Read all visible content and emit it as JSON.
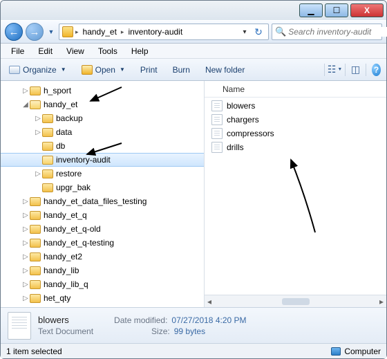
{
  "title": "",
  "winbuttons": {
    "min": "▁",
    "max": "☐",
    "close": "X"
  },
  "breadcrumb": {
    "p1": "handy_et",
    "p2": "inventory-audit"
  },
  "search": {
    "placeholder": "Search inventory-audit"
  },
  "menu": {
    "file": "File",
    "edit": "Edit",
    "view": "View",
    "tools": "Tools",
    "help": "Help"
  },
  "toolbar": {
    "organize": "Organize",
    "open": "Open",
    "print": "Print",
    "burn": "Burn",
    "newfolder": "New folder"
  },
  "column": {
    "name": "Name"
  },
  "tree": [
    {
      "indent": 30,
      "exp": "▷",
      "label": "h_sport",
      "open": false
    },
    {
      "indent": 30,
      "exp": "◢",
      "label": "handy_et",
      "open": true
    },
    {
      "indent": 48,
      "exp": "▷",
      "label": "backup",
      "open": false
    },
    {
      "indent": 48,
      "exp": "▷",
      "label": "data",
      "open": false
    },
    {
      "indent": 48,
      "exp": "",
      "label": "db",
      "open": false
    },
    {
      "indent": 48,
      "exp": "",
      "label": "inventory-audit",
      "open": true,
      "sel": true
    },
    {
      "indent": 48,
      "exp": "▷",
      "label": "restore",
      "open": false
    },
    {
      "indent": 48,
      "exp": "",
      "label": "upgr_bak",
      "open": false
    },
    {
      "indent": 30,
      "exp": "▷",
      "label": "handy_et_data_files_testing",
      "open": false
    },
    {
      "indent": 30,
      "exp": "▷",
      "label": "handy_et_q",
      "open": false
    },
    {
      "indent": 30,
      "exp": "▷",
      "label": "handy_et_q-old",
      "open": false
    },
    {
      "indent": 30,
      "exp": "▷",
      "label": "handy_et_q-testing",
      "open": false
    },
    {
      "indent": 30,
      "exp": "▷",
      "label": "handy_et2",
      "open": false
    },
    {
      "indent": 30,
      "exp": "▷",
      "label": "handy_lib",
      "open": false
    },
    {
      "indent": 30,
      "exp": "▷",
      "label": "handy_lib_q",
      "open": false
    },
    {
      "indent": 30,
      "exp": "▷",
      "label": "het_qty",
      "open": false
    }
  ],
  "files": [
    {
      "name": "blowers"
    },
    {
      "name": "chargers"
    },
    {
      "name": "compressors"
    },
    {
      "name": "drills"
    }
  ],
  "details": {
    "name": "blowers",
    "type": "Text Document",
    "modlabel": "Date modified:",
    "modval": "07/27/2018 4:20 PM",
    "sizelabel": "Size:",
    "sizeval": "99 bytes"
  },
  "status": {
    "left": "1 item selected",
    "right": "Computer"
  }
}
